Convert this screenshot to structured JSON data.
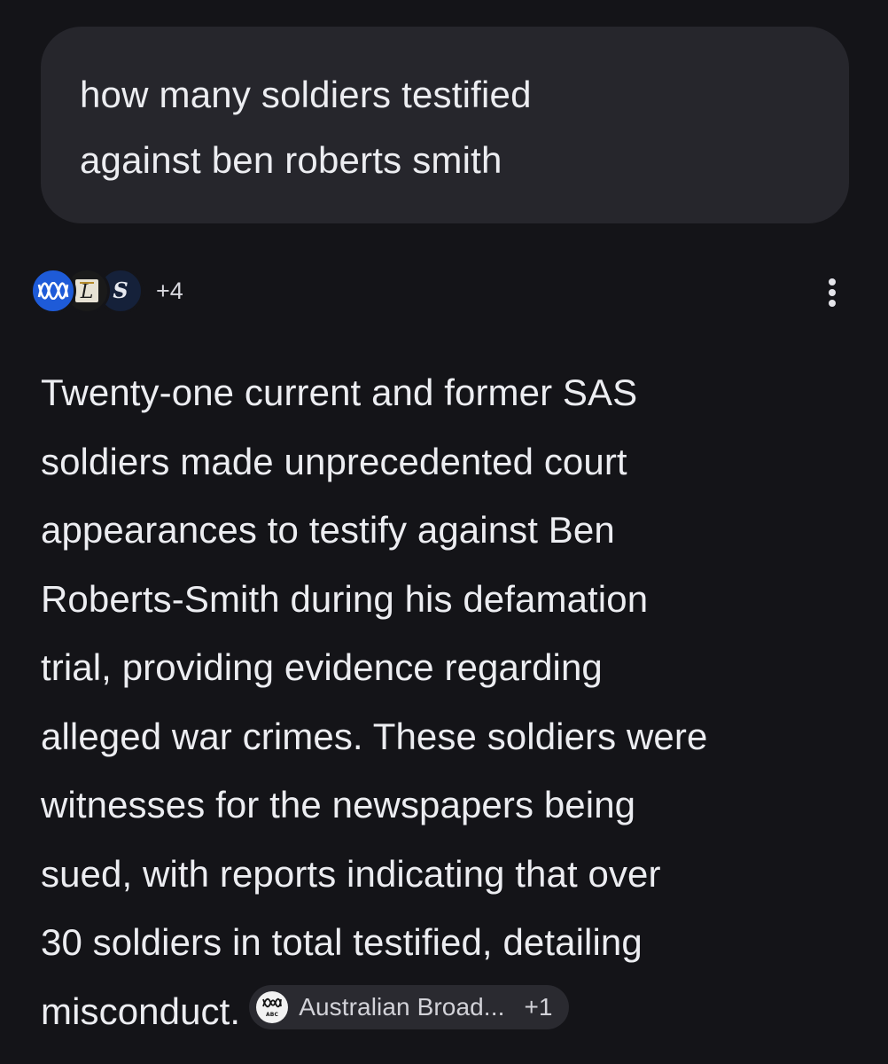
{
  "query": {
    "text": "how many soldiers testified\nagainst ben roberts smith"
  },
  "sources": {
    "icons": [
      "abc-logo-icon",
      "newspaper-logo-icon",
      "smh-logo-icon"
    ],
    "abc_logo_text": "ABC",
    "more_count": "+4"
  },
  "menu": {
    "icon": "more-vertical-icon"
  },
  "answer": {
    "lines": [
      "Twenty-one current and former SAS",
      "soldiers made unprecedented court",
      "appearances to testify against Ben",
      "Roberts-Smith during his defamation",
      "trial, providing evidence regarding",
      "alleged war crimes. These soldiers were",
      "witnesses for the newspapers being",
      "sued, with reports indicating that over",
      "30 soldiers in total testified, detailing",
      "misconduct."
    ]
  },
  "citation": {
    "label": "Australian Broad...",
    "count": "+1",
    "logo_text": "ABC"
  },
  "colors": {
    "background": "#141418",
    "bubble": "#26262c",
    "text": "#ecedf1",
    "abc_blue": "#1e5bd8",
    "chip": "#2a2a30"
  }
}
